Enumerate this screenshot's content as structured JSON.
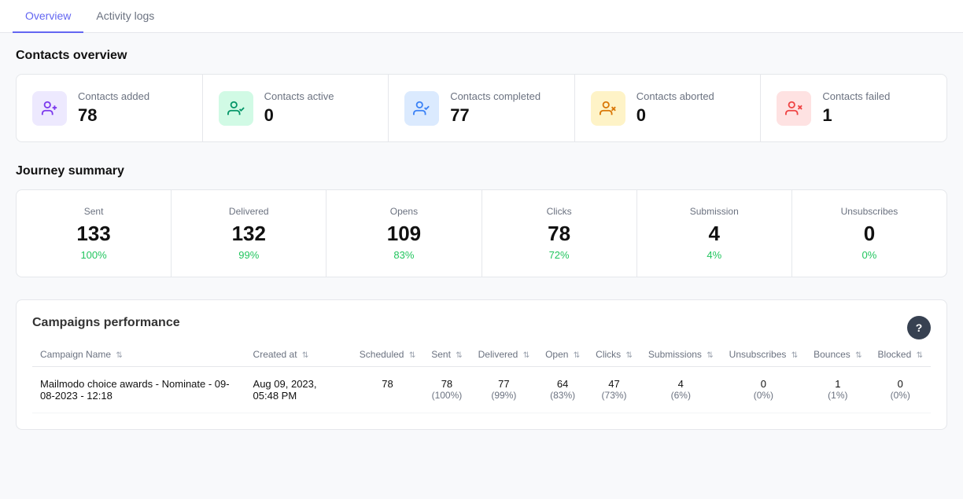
{
  "tabs": [
    {
      "id": "overview",
      "label": "Overview",
      "active": true
    },
    {
      "id": "activity-logs",
      "label": "Activity logs",
      "active": false
    }
  ],
  "contacts_overview": {
    "title": "Contacts overview",
    "cards": [
      {
        "id": "added",
        "label": "Contacts added",
        "value": "78",
        "icon_type": "purple",
        "icon_glyph": "👤+"
      },
      {
        "id": "active",
        "label": "Contacts active",
        "value": "0",
        "icon_type": "green",
        "icon_glyph": "👤"
      },
      {
        "id": "completed",
        "label": "Contacts completed",
        "value": "77",
        "icon_type": "blue",
        "icon_glyph": "👤✓"
      },
      {
        "id": "aborted",
        "label": "Contacts aborted",
        "value": "0",
        "icon_type": "orange",
        "icon_glyph": "👤✗"
      },
      {
        "id": "failed",
        "label": "Contacts failed",
        "value": "1",
        "icon_type": "pink",
        "icon_glyph": "👤!"
      }
    ]
  },
  "journey_summary": {
    "title": "Journey summary",
    "stats": [
      {
        "label": "Sent",
        "value": "133",
        "pct": "100%"
      },
      {
        "label": "Delivered",
        "value": "132",
        "pct": "99%"
      },
      {
        "label": "Opens",
        "value": "109",
        "pct": "83%"
      },
      {
        "label": "Clicks",
        "value": "78",
        "pct": "72%"
      },
      {
        "label": "Submission",
        "value": "4",
        "pct": "4%"
      },
      {
        "label": "Unsubscribes",
        "value": "0",
        "pct": "0%"
      }
    ]
  },
  "campaigns_performance": {
    "title": "Campaigns performance",
    "help_icon": "?",
    "columns": [
      {
        "id": "campaign-name",
        "label": "Campaign Name"
      },
      {
        "id": "created-at",
        "label": "Created at"
      },
      {
        "id": "scheduled",
        "label": "Scheduled"
      },
      {
        "id": "sent",
        "label": "Sent"
      },
      {
        "id": "delivered",
        "label": "Delivered"
      },
      {
        "id": "open",
        "label": "Open"
      },
      {
        "id": "clicks",
        "label": "Clicks"
      },
      {
        "id": "submissions",
        "label": "Submissions"
      },
      {
        "id": "unsubscribes",
        "label": "Unsubscribes"
      },
      {
        "id": "bounces",
        "label": "Bounces"
      },
      {
        "id": "blocked",
        "label": "Blocked"
      }
    ],
    "rows": [
      {
        "campaign_name": "Mailmodo choice awards - Nominate - 09-08-2023 - 12:18",
        "created_at": "Aug 09, 2023, 05:48 PM",
        "scheduled": "78",
        "sent": "78",
        "sent_pct": "(100%)",
        "delivered": "77",
        "delivered_pct": "(99%)",
        "open": "64",
        "open_pct": "(83%)",
        "clicks": "47",
        "clicks_pct": "(73%)",
        "submissions": "4",
        "submissions_pct": "(6%)",
        "unsubscribes": "0",
        "unsubscribes_pct": "(0%)",
        "bounces": "1",
        "bounces_pct": "(1%)",
        "blocked": "0",
        "blocked_pct": "(0%)"
      }
    ]
  }
}
